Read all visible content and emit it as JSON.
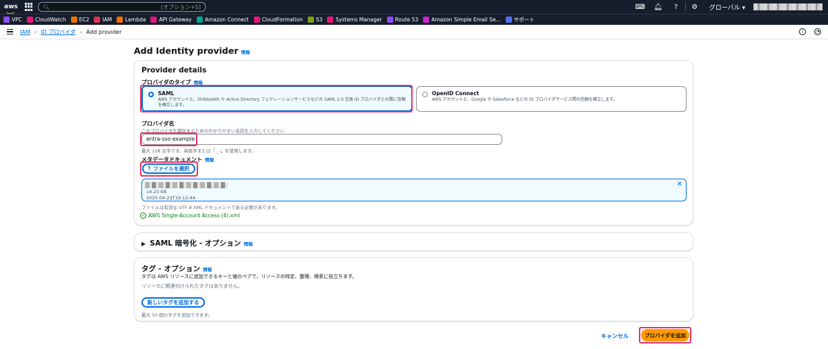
{
  "topbar": {
    "logo": "aws",
    "search_placeholder": "検索",
    "search_shortcut": "[オプション+S]",
    "region": "グローバル ▾",
    "icons": [
      "cloudshell-icon",
      "bell-icon",
      "help-icon",
      "gear-icon"
    ]
  },
  "favorites": [
    {
      "label": "VPC",
      "color": "#8c4fff"
    },
    {
      "label": "CloudWatch",
      "color": "#e7157b"
    },
    {
      "label": "EC2",
      "color": "#ed7100"
    },
    {
      "label": "IAM",
      "color": "#dd344c"
    },
    {
      "label": "Lambda",
      "color": "#ed7100"
    },
    {
      "label": "API Gateway",
      "color": "#e7157b"
    },
    {
      "label": "Amazon Connect",
      "color": "#01a88d"
    },
    {
      "label": "CloudFormation",
      "color": "#e7157b"
    },
    {
      "label": "S3",
      "color": "#7aa116"
    },
    {
      "label": "Systems Manager",
      "color": "#e7157b"
    },
    {
      "label": "Route 53",
      "color": "#8c4fff"
    },
    {
      "label": "Amazon Simple Email Se...",
      "color": "#c925d1"
    },
    {
      "label": "サポート",
      "color": "#4d72f3"
    }
  ],
  "breadcrumb": {
    "items": [
      "IAM",
      "ID プロバイダ",
      "Add provider"
    ]
  },
  "page": {
    "title": "Add Identity provider",
    "info": "情報"
  },
  "provider_details": {
    "title": "Provider details",
    "type_label": "プロバイダのタイプ",
    "info": "情報",
    "saml_title": "SAML",
    "saml_desc": "AWS アカウントと、Shibboleth や Active Directory フェデレーションサービスなどの SAML 2.0 互換 ID プロバイダとの間に信頼を確立します。",
    "oidc_title": "OpenID Connect",
    "oidc_desc": "AWS アカウントと、Google や Salesforce などの ID プロバイダサービス間の信頼を確立します。",
    "name_label": "プロバイダ名",
    "name_desc": "このプロバイダを識別するためのわかりやすい名前を入力してください",
    "name_value": "entra-sso-example",
    "name_hint": "最大 128 文字です。英数字または「._-」を使用します。",
    "metadata_label": "メタデータドキュメント",
    "choose_file": "ファイルを選択",
    "file_size": "14.23 KB",
    "file_date": "2025-04-23T19:12:44",
    "file_hint": "ファイルは有効な UTF-8 XML ドキュメントである必要があります。",
    "uploaded_file": "AWS Single-Account Access (4).xml"
  },
  "saml_encryption": {
    "title": "SAML 暗号化 - オプション",
    "info": "情報"
  },
  "tags": {
    "title": "タグ - オプション",
    "info": "情報",
    "desc": "タグは AWS リソースに追加できるキーと値のペアで、リソースの特定、整理、検索に役立ちます。",
    "empty": "リソースに関連付けられたタグはありません。",
    "add_button": "新しいタグを追加する",
    "limit": "最大 50 個のタグを追加できます。"
  },
  "footer": {
    "cancel": "キャンセル",
    "submit": "プロバイダを追加"
  }
}
